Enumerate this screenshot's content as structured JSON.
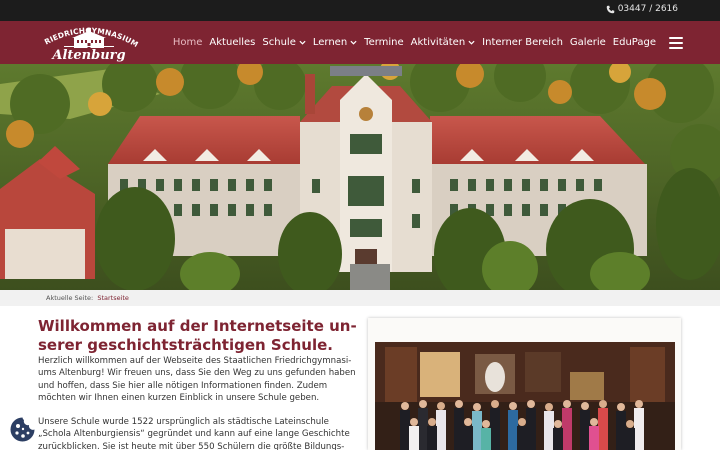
{
  "topbar": {
    "phone": "03447 / 2616",
    "phone_icon": "phone-icon"
  },
  "logo": {
    "line1": "FRIEDRICHGYMNASIUM",
    "line2": "Altenburg"
  },
  "nav": {
    "items": [
      {
        "label": "Home",
        "active": true,
        "dropdown": false
      },
      {
        "label": "Aktuelles",
        "active": false,
        "dropdown": false
      },
      {
        "label": "Schule",
        "active": false,
        "dropdown": true
      },
      {
        "label": "Lernen",
        "active": false,
        "dropdown": true
      },
      {
        "label": "Termine",
        "active": false,
        "dropdown": false
      },
      {
        "label": "Aktivitäten",
        "active": false,
        "dropdown": true
      },
      {
        "label": "Interner Bereich",
        "active": false,
        "dropdown": false
      },
      {
        "label": "Galerie",
        "active": false,
        "dropdown": false
      },
      {
        "label": "EduPage",
        "active": false,
        "dropdown": false
      }
    ],
    "menu_icon": "hamburger-menu-icon"
  },
  "breadcrumb": {
    "label": "Aktuelle Seite:",
    "current": "Startseite"
  },
  "content": {
    "title": "Willkommen auf der Internetseite un-serer geschichtsträchtigen Schule.",
    "paragraph1": "Herzlich willkommen auf der Webseite des Staatlichen Friedrichgymnasi-ums Altenburg! Wir freuen uns, dass Sie den Weg zu uns gefunden haben und hoffen, dass Sie hier alle nötigen Informationen finden. Zudem möchten wir Ihnen einen kurzen Einblick in unsere Schule geben.",
    "paragraph2": "Unsere Schule wurde 1522 ursprünglich als städtische Lateinschule „Schola Altenburgiensis“ gegründet und kann auf eine lange Geschichte zurückblicken. Sie ist heute mit über 550 Schülern die größte Bildungs-"
  },
  "colors": {
    "brand": "#7e2432",
    "topbar": "#1c1c1c",
    "active_nav": "#e8bcc3"
  },
  "cookie_icon": "cookie-icon"
}
